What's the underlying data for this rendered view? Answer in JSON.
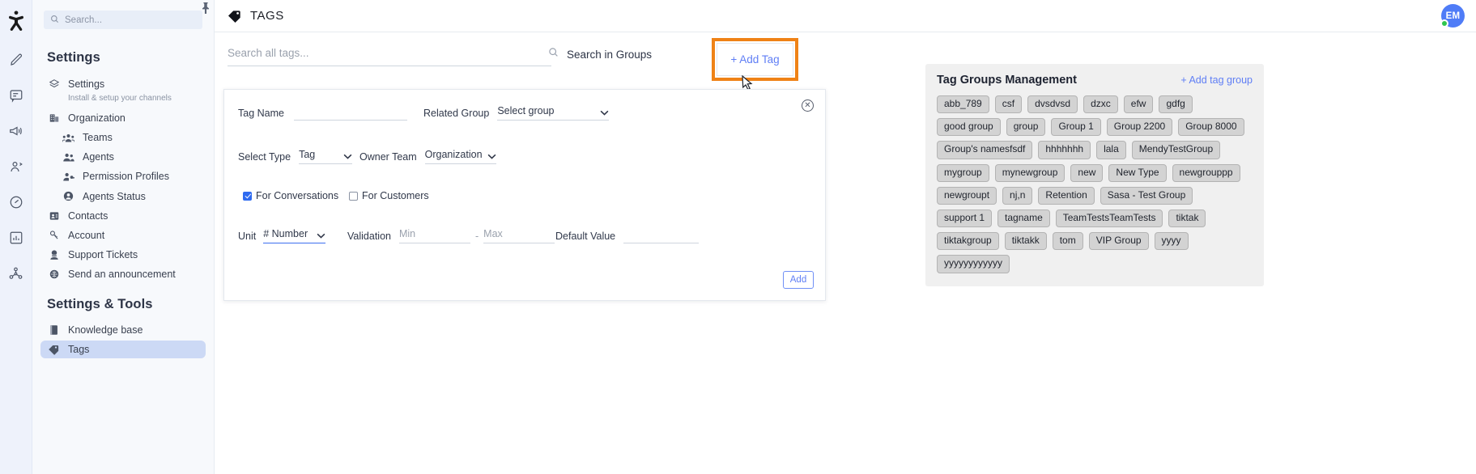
{
  "rail": {
    "logo_icon": "app-logo-icon",
    "items": [
      {
        "icon": "pencil-icon",
        "name": "compose"
      },
      {
        "icon": "chat-bubble-icon",
        "name": "conversations"
      },
      {
        "icon": "megaphone-icon",
        "name": "announcements"
      },
      {
        "icon": "contacts-icon",
        "name": "contacts"
      },
      {
        "icon": "gauge-icon",
        "name": "dashboard"
      },
      {
        "icon": "bar-chart-icon",
        "name": "reports"
      },
      {
        "icon": "integrations-icon",
        "name": "integrations"
      }
    ]
  },
  "sidebar": {
    "search_placeholder": "Search...",
    "title": "Settings",
    "items": [
      {
        "label": "Settings",
        "icon": "layers-icon",
        "desc": "Install & setup your channels",
        "indent": false,
        "selected": false
      },
      {
        "label": "Organization",
        "icon": "building-icon",
        "indent": false,
        "selected": false
      },
      {
        "label": "Teams",
        "icon": "teams-icon",
        "indent": true,
        "selected": false
      },
      {
        "label": "Agents",
        "icon": "agents-icon",
        "indent": true,
        "selected": false
      },
      {
        "label": "Permission Profiles",
        "icon": "permission-icon",
        "indent": true,
        "selected": false
      },
      {
        "label": "Agents Status",
        "icon": "agent-status-icon",
        "indent": true,
        "selected": false
      },
      {
        "label": "Contacts",
        "icon": "contact-card-icon",
        "indent": false,
        "selected": false
      },
      {
        "label": "Account",
        "icon": "key-icon",
        "indent": false,
        "selected": false
      },
      {
        "label": "Support Tickets",
        "icon": "support-icon",
        "indent": false,
        "selected": false
      },
      {
        "label": "Send an announcement",
        "icon": "announcement-icon",
        "indent": false,
        "selected": false
      }
    ],
    "subtitle": "Settings & Tools",
    "tools": [
      {
        "label": "Knowledge base",
        "icon": "book-icon",
        "selected": false
      },
      {
        "label": "Tags",
        "icon": "tag-icon",
        "selected": true
      }
    ]
  },
  "header": {
    "title": "TAGS",
    "title_icon": "tag-icon",
    "pin_icon": "pin-icon",
    "avatar_initials": "EM",
    "avatar_color": "#4f7cf7",
    "status_color": "#2fc64f"
  },
  "toolbar": {
    "tag_search_placeholder": "Search all tags...",
    "group_search_label": "Search in Groups",
    "group_search_icon": "search-icon",
    "chevron_icon": "chevron-down-icon",
    "add_tag_label": "+ Add Tag",
    "highlight_color": "#ef8216"
  },
  "modal": {
    "close_icon": "close-circle-icon",
    "tag_name_label": "Tag Name",
    "tag_name_value": "",
    "related_group_label": "Related Group",
    "related_group_value": "Select group",
    "select_type_label": "Select Type",
    "select_type_value": "Tag",
    "owner_team_label": "Owner Team",
    "owner_team_value": "Organization",
    "for_conversations_label": "For Conversations",
    "for_conversations_checked": true,
    "for_customers_label": "For Customers",
    "for_customers_checked": false,
    "unit_label": "Unit",
    "unit_value": "# Number",
    "validation_label": "Validation",
    "validation_min_placeholder": "Min",
    "validation_separator": "-",
    "validation_max_placeholder": "Max",
    "default_value_label": "Default Value",
    "default_value": "",
    "add_button_label": "Add"
  },
  "tag_groups": {
    "title": "Tag Groups Management",
    "add_label": "+ Add tag group",
    "chips": [
      "abb_789",
      "csf",
      "dvsdvsd",
      "dzxc",
      "efw",
      "gdfg",
      "good group",
      "group",
      "Group 1",
      "Group 2200",
      "Group 8000",
      "Group's namesfsdf",
      "hhhhhhh",
      "lala",
      "MendyTestGroup",
      "mygroup",
      "mynewgroup",
      "new",
      "New Type",
      "newgrouppp",
      "newgroupt",
      "nj,n",
      "Retention",
      "Sasa - Test Group",
      "support 1",
      "tagname",
      "TeamTestsTeamTests",
      "tiktak",
      "tiktakgroup",
      "tiktakk",
      "tom",
      "VIP Group",
      "yyyy",
      "yyyyyyyyyyyy"
    ]
  }
}
